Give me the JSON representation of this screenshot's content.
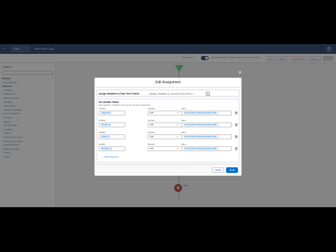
{
  "topbar": {
    "tabs": [
      "Flow Builder",
      "New Flow Copy 1 - V1"
    ],
    "help": "?"
  },
  "toolbar": {
    "auto_layout_label": "Auto-Layout",
    "toggle_hint": "Auto-Layout is On; click to switch to Free-Form layout",
    "buttons": [
      "Run",
      "Debug",
      "Deactivate",
      "Save As",
      "Save"
    ]
  },
  "left_panel": {
    "title": "Toolbox",
    "items": [
      "Manager",
      "New Resource",
      "Elements",
      "Decisions",
      "Assignments",
      "Record Lookups",
      "Variables",
      "Apex Classes",
      "Collection Variables",
      "Record Variables",
      "Formulas",
      "Stages",
      "Text Templates",
      "Constants",
      "Choices",
      "Picklist Choice Sets",
      "Screen Components",
      "Global Variables",
      "Other Resources",
      "Outputs",
      "Inputs"
    ]
  },
  "canvas": {
    "end_label": "End"
  },
  "modal": {
    "title": "Edit Assignment",
    "label_caption": "Assign Variables to Clear Text Criteria",
    "label_value": "{!Assign_Variables_to_Censored_Text_Criteri...}",
    "section_title": "Set Variable Values",
    "section_desc": "Each variable is modified by the operator and value combination.",
    "rows": [
      {
        "variable_caption": "Variable",
        "variable": "Asignl.Mt...",
        "operator_caption": "Operator",
        "operator": "Add",
        "value_caption": "Value",
        "value": "Current Record Recipient.Data_MSG..."
      },
      {
        "variable_caption": "Variable",
        "variable": "Number_b",
        "operator_caption": "Operator",
        "operator": "Add",
        "value_caption": "Value",
        "value": "Current Record Recipient.Data_MSG..."
      },
      {
        "variable_caption": "Variable",
        "variable": "eflhell_fs",
        "operator_caption": "Operator",
        "operator": "Add",
        "value_caption": "Value",
        "value": "Current Record Recipient.Data_MSG..."
      },
      {
        "variable_caption": "Variable",
        "variable": "Recipient_s",
        "operator_caption": "Operator",
        "operator": "Add",
        "value_caption": "Value",
        "value": "Current Record Recipient.Data_MSG..."
      }
    ],
    "add_assignment": "+ Add Assignment",
    "cancel": "Cancel",
    "done": "Done"
  }
}
